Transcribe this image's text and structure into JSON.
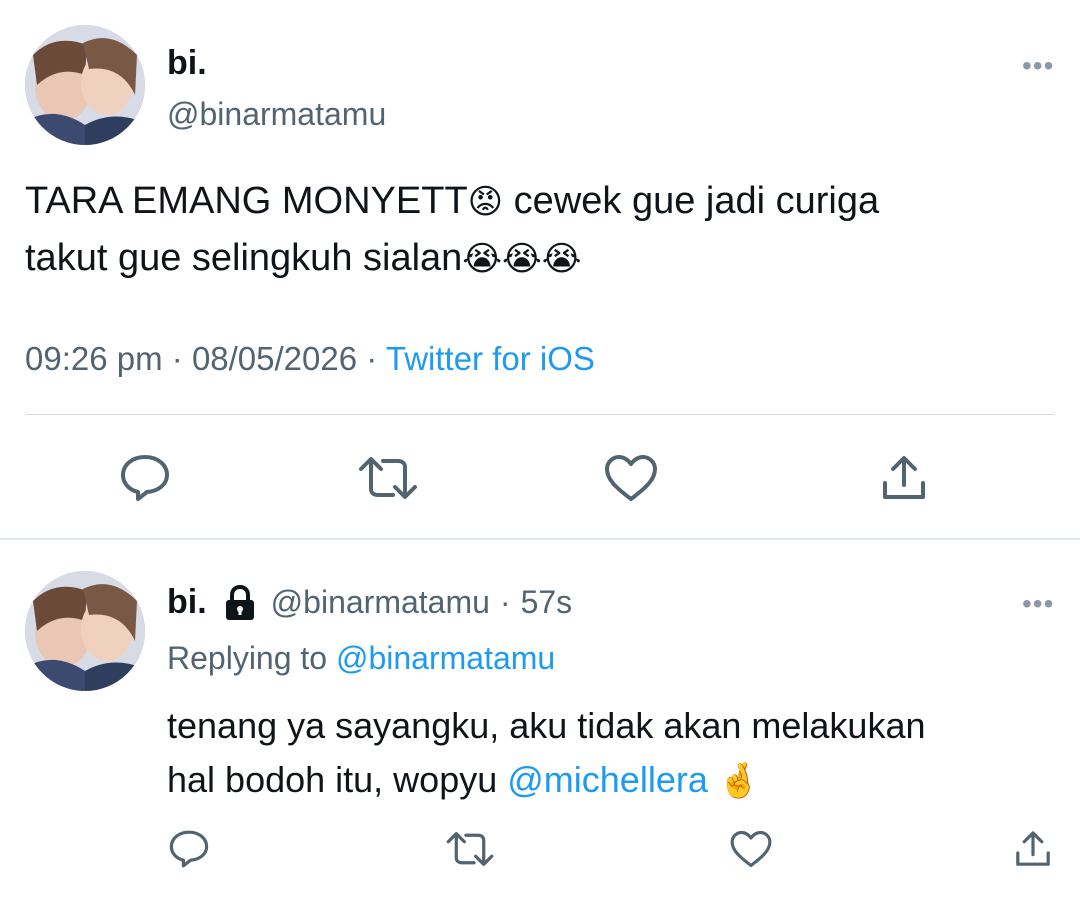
{
  "main_tweet": {
    "display_name": "bi.",
    "handle": "@binarmatamu",
    "more_label": "•••",
    "text_line1": "TARA EMANG MONYETT",
    "emoji_angry": "😡",
    "text_line1b": " cewek gue jadi curiga",
    "text_line2": "takut gue selingkuh sialan",
    "emoji_cry": "😭😭😭",
    "time": "09:26 pm",
    "date": "08/05/2026",
    "sep": "·",
    "source": "Twitter for iOS"
  },
  "reply_tweet": {
    "display_name": "bi.",
    "handle": "@binarmatamu",
    "sep": "·",
    "age": "57s",
    "more_label": "•••",
    "replying_prefix": "Replying to",
    "replying_handle": "@binarmatamu",
    "text_line1": "tenang ya sayangku, aku tidak akan melakukan",
    "text_line2": "hal bodoh itu, wopyu ",
    "mention": "@michellera",
    "emoji_fingers": "🤞"
  },
  "icons": {
    "reply": "reply-icon",
    "retweet": "retweet-icon",
    "like": "heart-icon",
    "share": "share-icon",
    "lock": "lock-icon",
    "more": "more-icon"
  },
  "colors": {
    "text": "#0f1419",
    "secondary": "#536471",
    "link": "#1d9bf0",
    "divider": "#cfd9de"
  }
}
